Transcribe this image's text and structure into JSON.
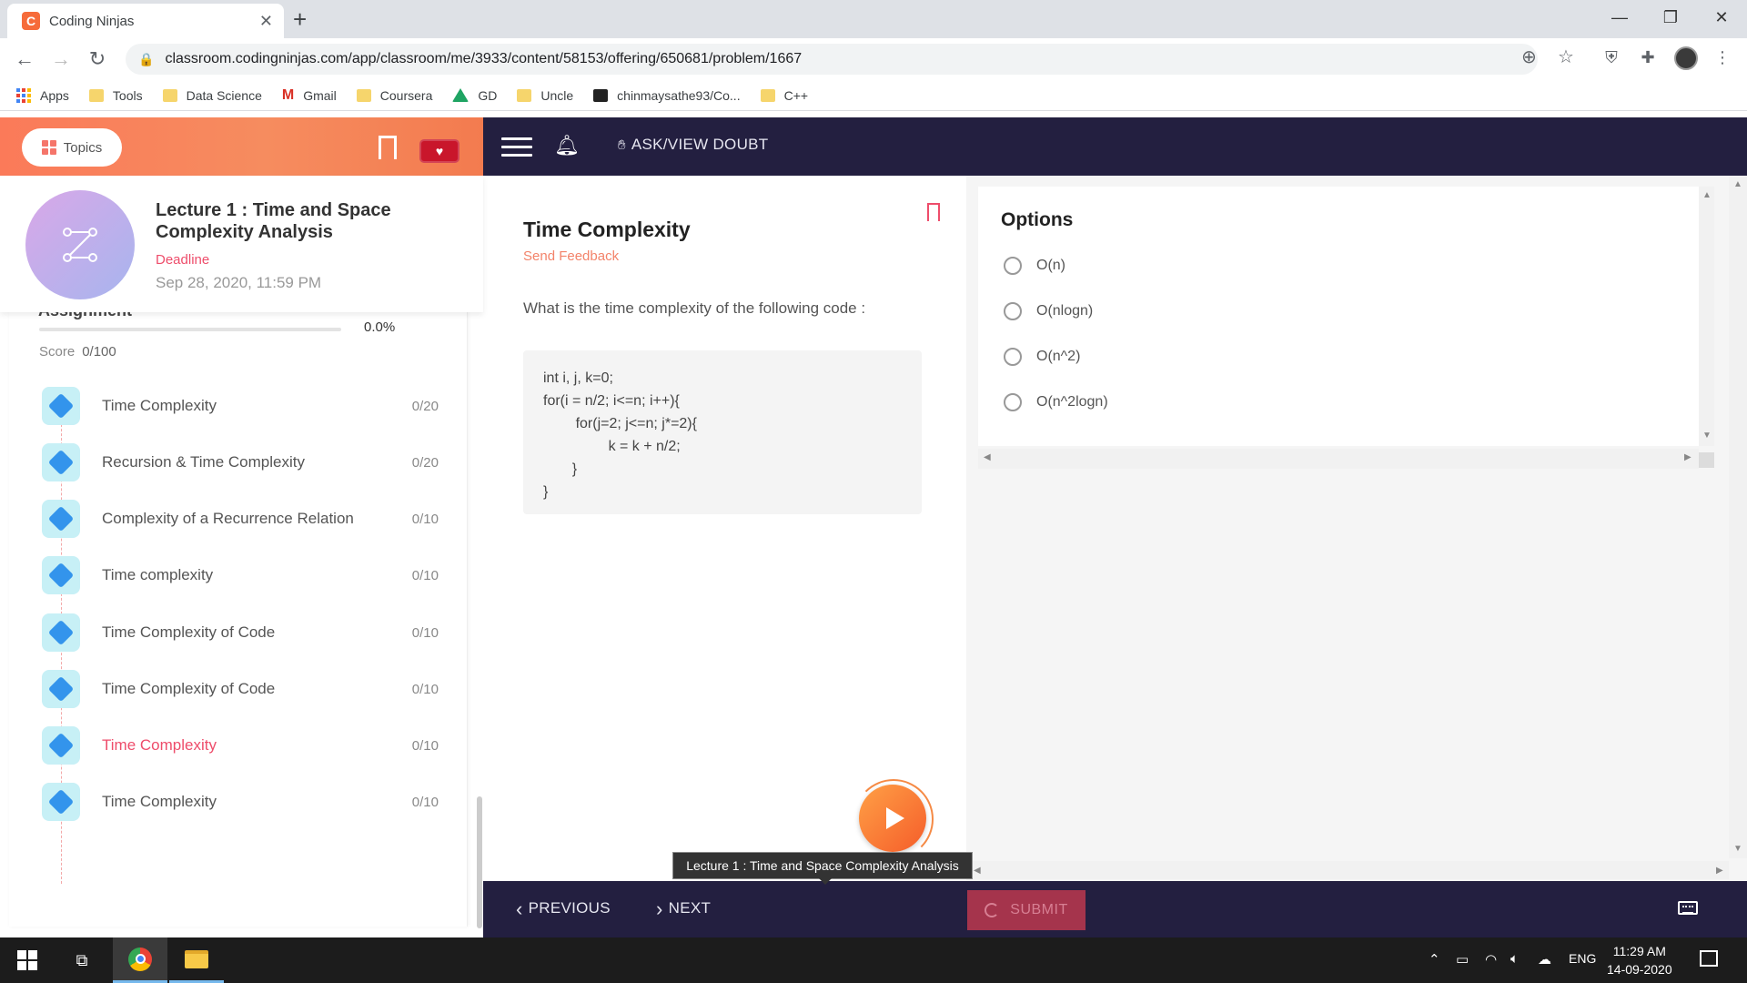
{
  "browser": {
    "tab_title": "Coding Ninjas",
    "tab_favicon": "C",
    "url": "classroom.codingninjas.com/app/classroom/me/3933/content/58153/offering/650681/problem/1667",
    "bookmarks": [
      "Apps",
      "Tools",
      "Data Science",
      "Gmail",
      "Coursera",
      "GD",
      "Uncle",
      "chinmaysathe93/Co...",
      "C++"
    ]
  },
  "header": {
    "topics_label": "Topics",
    "doubt_label": "ASK/VIEW DOUBT"
  },
  "lecture": {
    "title": "Lecture 1 : Time and Space Complexity Analysis",
    "deadline_label": "Deadline",
    "deadline_date": "Sep 28, 2020, 11:59 PM"
  },
  "assignment": {
    "heading": "Assignment",
    "progress_pct": "0.0%",
    "progress_value": 0,
    "score_label": "Score",
    "score_value": "0/100",
    "items": [
      {
        "name": "Time Complexity",
        "score": "0/20",
        "active": false
      },
      {
        "name": "Recursion & Time Complexity",
        "score": "0/20",
        "active": false
      },
      {
        "name": "Complexity of a Recurrence Relation",
        "score": "0/10",
        "active": false
      },
      {
        "name": "Time complexity",
        "score": "0/10",
        "active": false
      },
      {
        "name": "Time Complexity of Code",
        "score": "0/10",
        "active": false
      },
      {
        "name": "Time Complexity of Code",
        "score": "0/10",
        "active": false
      },
      {
        "name": "Time Complexity",
        "score": "0/10",
        "active": true
      },
      {
        "name": "Time Complexity",
        "score": "0/10",
        "active": false
      }
    ]
  },
  "question": {
    "title": "Time Complexity",
    "feedback_label": "Send Feedback",
    "text": "What is the time complexity of the following code :",
    "code": [
      "int i, j, k=0;",
      "for(i = n/2; i<=n; i++){",
      "        for(j=2; j<=n; j*=2){",
      "        k = k + n/2;",
      "    }",
      "}"
    ]
  },
  "options": {
    "title": "Options",
    "choices": [
      "O(n)",
      "O(nlogn)",
      "O(n^2)",
      "O(n^2logn)"
    ]
  },
  "tooltip": "Lecture 1 : Time and Space Complexity Analysis",
  "footer": {
    "previous_label": "PREVIOUS",
    "next_label": "NEXT",
    "submit_label": "SUBMIT"
  },
  "taskbar": {
    "lang": "ENG",
    "time": "11:29 AM",
    "date": "14-09-2020"
  },
  "colors": {
    "accent": "#ee4d6b",
    "dark_header": "#231f40",
    "orange": "#f68c5f"
  }
}
